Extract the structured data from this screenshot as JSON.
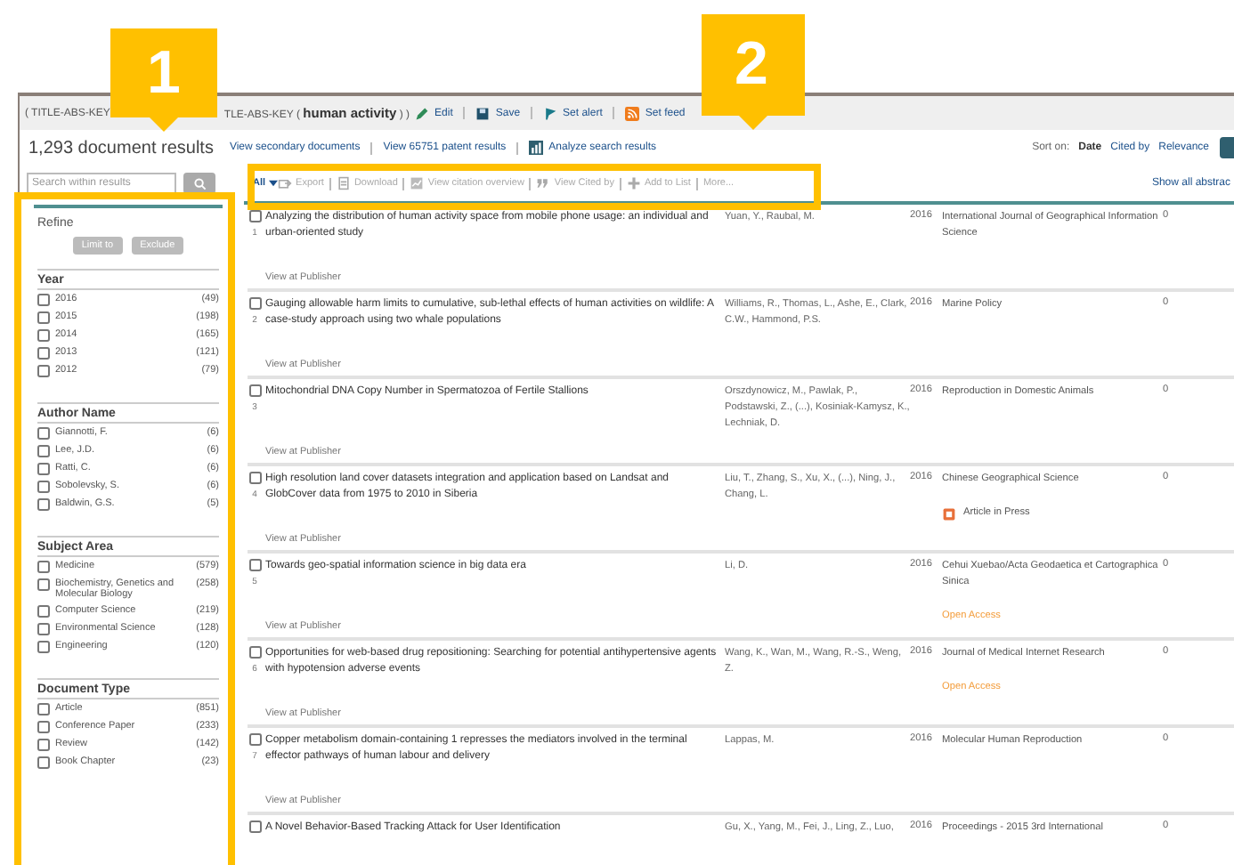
{
  "callouts": [
    {
      "label": "1"
    },
    {
      "label": "2"
    }
  ],
  "query": {
    "text_left": "( TITLE-ABS-KEY",
    "text_right": "TLE-ABS-KEY ( **human activity** ) )"
  },
  "query_actions": [
    {
      "kind": "edit",
      "label": "Edit"
    },
    {
      "kind": "save",
      "label": "Save"
    },
    {
      "kind": "alert",
      "label": "Set alert"
    },
    {
      "kind": "feed",
      "label": "Set feed"
    }
  ],
  "results_header": {
    "count": "1,293",
    "label": "document results",
    "links": [
      {
        "kind": "link",
        "label": "View secondary documents"
      },
      {
        "kind": "link",
        "label": "View 65751 patent results"
      },
      {
        "kind": "analyze",
        "label": "Analyze search results"
      }
    ]
  },
  "sort": {
    "label": "Sort on:",
    "options": [
      {
        "label": "Date",
        "selected": true
      },
      {
        "label": "Cited by",
        "selected": false
      },
      {
        "label": "Relevance",
        "selected": false
      }
    ]
  },
  "search": {
    "placeholder": "Search within results"
  },
  "toolbar": [
    {
      "kind": "all",
      "label": "All",
      "disabled": false
    },
    {
      "kind": "export",
      "label": "Export",
      "disabled": true
    },
    {
      "kind": "download",
      "label": "Download",
      "disabled": true
    },
    {
      "kind": "citation",
      "label": "View citation overview",
      "disabled": true
    },
    {
      "kind": "citedby",
      "label": "View Cited by",
      "disabled": true
    },
    {
      "kind": "add",
      "label": "Add to List",
      "disabled": true
    },
    {
      "kind": "more",
      "label": "More...",
      "disabled": true
    }
  ],
  "show_abstracts": "Show all abstrac",
  "refine": {
    "title": "Refine",
    "buttons": [
      "Limit to",
      "Exclude"
    ],
    "facets": [
      {
        "title": "Year",
        "items": [
          {
            "label": "2016",
            "count": "(49)",
            "checked": false
          },
          {
            "label": "2015",
            "count": "(198)",
            "checked": false
          },
          {
            "label": "2014",
            "count": "(165)",
            "checked": false
          },
          {
            "label": "2013",
            "count": "(121)",
            "checked": false
          },
          {
            "label": "2012",
            "count": "(79)",
            "checked": false
          }
        ]
      },
      {
        "title": "Author Name",
        "items": [
          {
            "label": "Giannotti, F.",
            "count": "(6)",
            "checked": false
          },
          {
            "label": "Lee, J.D.",
            "count": "(6)",
            "checked": false
          },
          {
            "label": "Ratti, C.",
            "count": "(6)",
            "checked": false
          },
          {
            "label": "Sobolevsky, S.",
            "count": "(6)",
            "checked": false
          },
          {
            "label": "Baldwin, G.S.",
            "count": "(5)",
            "checked": false
          }
        ]
      },
      {
        "title": "Subject Area",
        "items": [
          {
            "label": "Medicine",
            "count": "(579)",
            "checked": false
          },
          {
            "label": "Biochemistry, Genetics and Molecular Biology",
            "count": "(258)",
            "checked": false
          },
          {
            "label": "Computer Science",
            "count": "(219)",
            "checked": false
          },
          {
            "label": "Environmental Science",
            "count": "(128)",
            "checked": false
          },
          {
            "label": "Engineering",
            "count": "(120)",
            "checked": false
          }
        ]
      },
      {
        "title": "Document Type",
        "items": [
          {
            "label": "Article",
            "count": "(851)",
            "checked": false
          },
          {
            "label": "Conference Paper",
            "count": "(233)",
            "checked": false
          },
          {
            "label": "Review",
            "count": "(142)",
            "checked": false
          },
          {
            "label": "Book Chapter",
            "count": "(23)",
            "checked": false
          }
        ]
      }
    ]
  },
  "results": [
    {
      "number": "1",
      "title": "Analyzing the distribution of human activity space from mobile phone usage: an individual and urban-oriented study",
      "authors": "Yuan, Y., Raubal, M.",
      "year": "2016",
      "source": "International Journal of Geographical Information Science",
      "cited": "0",
      "checked": false,
      "publisher": "View at Publisher"
    },
    {
      "number": "2",
      "title": "Gauging allowable harm limits to cumulative, sub-lethal effects of human activities on wildlife: A case-study approach using two whale populations",
      "authors": "Williams, R., Thomas, L., Ashe, E., Clark, C.W., Hammond, P.S.",
      "year": "2016",
      "source": "Marine Policy",
      "cited": "0",
      "checked": false,
      "publisher": "View at Publisher"
    },
    {
      "number": "3",
      "title": "Mitochondrial DNA Copy Number in Spermatozoa of Fertile Stallions",
      "authors": "Orszdynowicz, M., Pawlak, P., Podstawski, Z., (...), Kosiniak-Kamysz, K., Lechniak, D.",
      "year": "2016",
      "source": "Reproduction in Domestic Animals",
      "cited": "0",
      "checked": false,
      "publisher": "View at Publisher"
    },
    {
      "number": "4",
      "title": "High resolution land cover datasets integration and application based on Landsat and GlobCover data from 1975 to 2010 in Siberia",
      "authors": "Liu, T., Zhang, S., Xu, X., (...), Ning, J., Chang, L.",
      "year": "2016",
      "source": "Chinese Geographical Science",
      "cited": "0",
      "checked": false,
      "badge": {
        "kind": "press",
        "label": "Article in Press"
      },
      "publisher": "View at Publisher"
    },
    {
      "number": "5",
      "title": "Towards geo-spatial information science in big data era",
      "authors": "Li, D.",
      "year": "2016",
      "source": "Cehui Xuebao/Acta Geodaetica et Cartographica Sinica",
      "cited": "0",
      "checked": false,
      "badge": {
        "kind": "open",
        "label": "Open Access"
      },
      "publisher": "View at Publisher"
    },
    {
      "number": "6",
      "title": "Opportunities for web-based drug repositioning: Searching for potential antihypertensive agents with hypotension adverse events",
      "authors": "Wang, K., Wan, M., Wang, R.-S., Weng, Z.",
      "year": "2016",
      "source": "Journal of Medical Internet Research",
      "cited": "0",
      "checked": false,
      "badge": {
        "kind": "open",
        "label": "Open Access"
      },
      "publisher": "View at Publisher"
    },
    {
      "number": "7",
      "title": "Copper metabolism domain-containing 1 represses the mediators involved in the terminal effector pathways of human labour and delivery",
      "authors": "Lappas, M.",
      "year": "2016",
      "source": "Molecular Human Reproduction",
      "cited": "0",
      "checked": false,
      "publisher": "View at Publisher"
    },
    {
      "title": "A Novel Behavior-Based Tracking Attack for User Identification",
      "authors": "Gu, X., Yang, M., Fei, J., Ling, Z., Luo,",
      "year": "2016",
      "source": "Proceedings - 2015 3rd International",
      "cited": "0",
      "checked": false
    }
  ]
}
